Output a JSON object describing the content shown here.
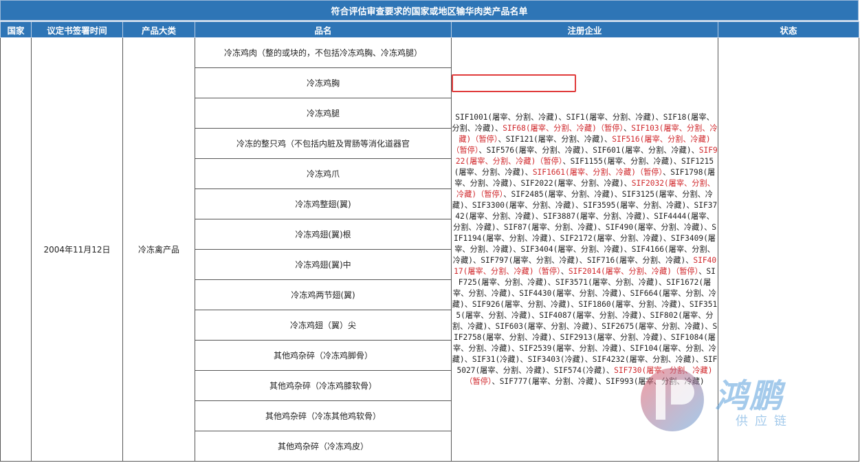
{
  "title": "符合评估审查要求的国家或地区输华肉类产品名单",
  "headers": {
    "country": "国家",
    "sign_date": "议定书签署时间",
    "category": "产品大类",
    "product": "品名",
    "company": "注册企业",
    "status": "状态"
  },
  "row": {
    "country": "",
    "sign_date": "2004年11月12日",
    "category": "冷冻禽产品",
    "status": ""
  },
  "products": [
    "冷冻鸡肉（整的或块的，不包括冷冻鸡胸、冷冻鸡腿）",
    "冷冻鸡胸",
    "冷冻鸡腿",
    "冷冻的整只鸡（不包括内脏及胃肠等消化道器官",
    "冷冻鸡爪",
    "冷冻鸡整翅(翼)",
    "冷冻鸡翅(翼)根",
    "冷冻鸡翅(翼)中",
    "冷冻鸡两节翅(翼)",
    "冷冻鸡翅（翼）尖",
    "其他鸡杂碎（冷冻鸡脚骨）",
    "其他鸡杂碎（冷冻鸡膝软骨）",
    "其他鸡杂碎（冷冻其他鸡软骨）",
    "其他鸡杂碎（冷冻鸡皮）"
  ],
  "companies": [
    {
      "text": "SIF1001(屠宰、分割、冷藏)",
      "suspended": false
    },
    {
      "text": "SIF1(屠宰、分割、冷藏)",
      "suspended": false
    },
    {
      "text": "SIF18(屠宰、分割、冷藏)",
      "suspended": false
    },
    {
      "text": "SIF68(屠宰、分割、冷藏)（暂停）",
      "suspended": true
    },
    {
      "text": "SIF103(屠宰、分割、冷藏)（暂停）",
      "suspended": true
    },
    {
      "text": "SIF121(屠宰、分割、冷藏)",
      "suspended": false
    },
    {
      "text": "SIF516(屠宰、分割、冷藏)（暂停）",
      "suspended": true
    },
    {
      "text": "SIF576(屠宰、分割、冷藏)",
      "suspended": false
    },
    {
      "text": "SIF601(屠宰、分割、冷藏)",
      "suspended": false
    },
    {
      "text": "SIF922(屠宰、分割、冷藏)（暂停）",
      "suspended": true
    },
    {
      "text": "SIF1155(屠宰、分割、冷藏)",
      "suspended": false
    },
    {
      "text": "SIF1215(屠宰、分割、冷藏)",
      "suspended": false
    },
    {
      "text": "SIF1661(屠宰、分割、冷藏)（暂停）",
      "suspended": true
    },
    {
      "text": "SIF1798(屠宰、分割、冷藏)",
      "suspended": false
    },
    {
      "text": "SIF2022(屠宰、分割、冷藏)",
      "suspended": false
    },
    {
      "text": "SIF2032(屠宰、分割、冷藏)（暂停）",
      "suspended": true
    },
    {
      "text": "SIF2485(屠宰、分割、冷藏)",
      "suspended": false
    },
    {
      "text": "SIF3125(屠宰、分割、冷藏)",
      "suspended": false
    },
    {
      "text": "SIF3300(屠宰、分割、冷藏)",
      "suspended": false
    },
    {
      "text": "SIF3595(屠宰、分割、冷藏)",
      "suspended": false
    },
    {
      "text": "SIF3742(屠宰、分割、冷藏)",
      "suspended": false
    },
    {
      "text": "SIF3887(屠宰、分割、冷藏)",
      "suspended": false
    },
    {
      "text": "SIF4444(屠宰、分割、冷藏)",
      "suspended": false
    },
    {
      "text": "SIF87(屠宰、分割、冷藏)",
      "suspended": false
    },
    {
      "text": "SIF490(屠宰、分割、冷藏)",
      "suspended": false
    },
    {
      "text": "SIF1194(屠宰、分割、冷藏)",
      "suspended": false
    },
    {
      "text": "SIF2172(屠宰、分割、冷藏)",
      "suspended": false
    },
    {
      "text": "SIF3409(屠宰、分割、冷藏)",
      "suspended": false
    },
    {
      "text": "SIF3404(屠宰、分割、冷藏)",
      "suspended": false
    },
    {
      "text": "SIF4166(屠宰、分割、冷藏)",
      "suspended": false
    },
    {
      "text": "SIF797(屠宰、分割、冷藏)",
      "suspended": false
    },
    {
      "text": "SIF716(屠宰、分割、冷藏)",
      "suspended": false
    },
    {
      "text": "SIF4017(屠宰、分割、冷藏)（暂停）",
      "suspended": true
    },
    {
      "text": "SIF2014(屠宰、分割、冷藏)（暂停）",
      "suspended": true
    },
    {
      "text": "SIF725(屠宰、分割、冷藏)",
      "suspended": false
    },
    {
      "text": "SIF3571(屠宰、分割、冷藏)",
      "suspended": false
    },
    {
      "text": "SIF1672(屠宰、分割、冷藏)",
      "suspended": false
    },
    {
      "text": "SIF4430(屠宰、分割、冷藏)",
      "suspended": false
    },
    {
      "text": "SIF664(屠宰、分割、冷藏)",
      "suspended": false
    },
    {
      "text": "SIF926(屠宰、分割、冷藏)",
      "suspended": false
    },
    {
      "text": "SIF1860(屠宰、分割、冷藏)",
      "suspended": false
    },
    {
      "text": "SIF3515(屠宰、分割、冷藏)",
      "suspended": false
    },
    {
      "text": "SIF4087(屠宰、分割、冷藏)",
      "suspended": false
    },
    {
      "text": "SIF802(屠宰、分割、冷藏)",
      "suspended": false
    },
    {
      "text": "SIF603(屠宰、分割、冷藏)",
      "suspended": false
    },
    {
      "text": "SIF2675(屠宰、分割、冷藏)",
      "suspended": false
    },
    {
      "text": "SIF2758(屠宰、分割、冷藏)",
      "suspended": false
    },
    {
      "text": "SIF2913(屠宰、分割、冷藏)",
      "suspended": false
    },
    {
      "text": "SIF1084(屠宰、分割、冷藏)",
      "suspended": false
    },
    {
      "text": "SIF2539(屠宰、分割、冷藏)",
      "suspended": false
    },
    {
      "text": "SIF104(屠宰、分割、冷藏)",
      "suspended": false
    },
    {
      "text": "SIF31(冷藏)",
      "suspended": false
    },
    {
      "text": "SIF3403(冷藏)",
      "suspended": false
    },
    {
      "text": "SIF4232(屠宰、分割、冷藏)",
      "suspended": false
    },
    {
      "text": "SIF5027(屠宰、分割、冷藏)",
      "suspended": false
    },
    {
      "text": "SIF574(冷藏)",
      "suspended": false
    },
    {
      "text": "SIF730(屠宰、分割、冷藏)（暂停）",
      "suspended": true
    },
    {
      "text": "SIF777(屠宰、分割、冷藏)",
      "suspended": false
    },
    {
      "text": "SIF993(屠宰、分割、冷藏)",
      "suspended": false
    }
  ],
  "separator": "、",
  "watermark": {
    "brand": "鸿鹏",
    "subtitle": "供应链"
  },
  "colors": {
    "header_bg": "#2E75B6",
    "suspended_text": "#d0272b",
    "highlight_border": "#e03a3a"
  }
}
